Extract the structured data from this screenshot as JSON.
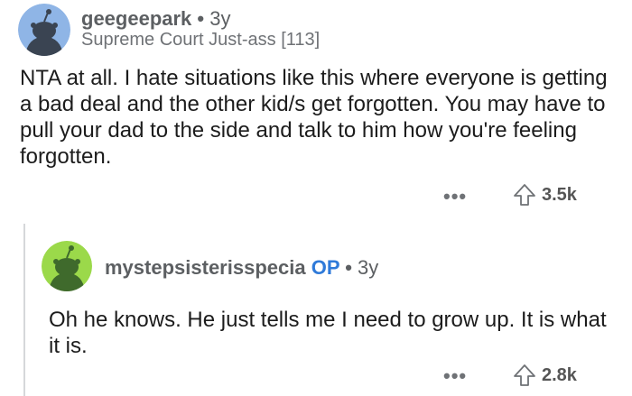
{
  "comments": [
    {
      "username": "geegeepark",
      "separator": "•",
      "age": "3y",
      "flair": "Supreme Court Just-ass [113]",
      "body": "NTA at all. I hate situations like this where everyone is getting a bad deal and the other kid/s get forgotten. You may have to pull your dad to the side and talk to him how you're feeling forgotten.",
      "more": "•••",
      "upvotes": "3.5k",
      "avatar_color": "#8fb5e6"
    },
    {
      "username": "mystepsisterisspecia",
      "op_badge": "OP",
      "separator": "•",
      "age": "3y",
      "body": "Oh he knows. He just tells me I need to grow up. It is what it is.",
      "more": "•••",
      "upvotes": "2.8k",
      "avatar_color": "#9bd94a"
    }
  ],
  "icons": {
    "more": "more-options-icon",
    "upvote": "upvote-arrow-icon"
  }
}
